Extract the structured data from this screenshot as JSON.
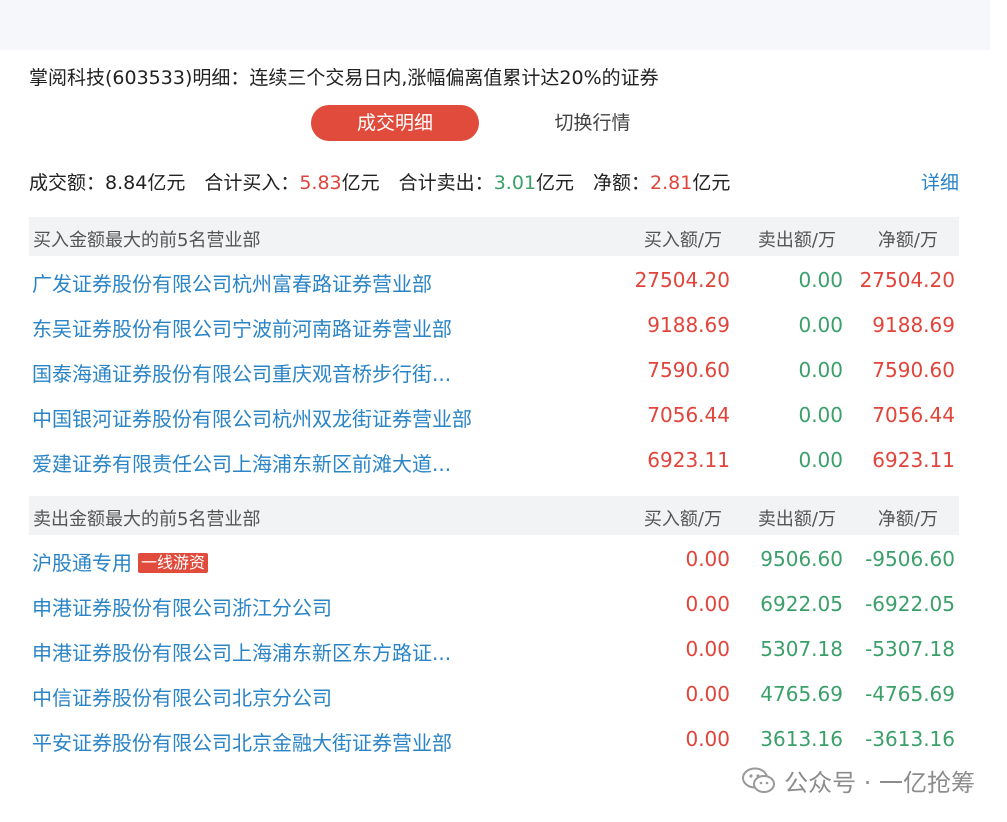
{
  "title": "掌阅科技(603533)明细：连续三个交易日内,涨幅偏离值累计达20%的证券",
  "tabs": [
    {
      "label": "成交明细",
      "active": true
    },
    {
      "label": "切换行情",
      "active": false
    }
  ],
  "summary": {
    "turnover_label": "成交额：",
    "turnover_value": "8.84亿元",
    "buy_label": "合计买入：",
    "buy_value": "5.83",
    "buy_unit": "亿元",
    "sell_label": "合计卖出：",
    "sell_value": "3.01",
    "sell_unit": "亿元",
    "net_label": "净额：",
    "net_value": "2.81",
    "net_unit": "亿元",
    "detail_link": "详细"
  },
  "buy_section": {
    "title": "买入金额最大的前5名营业部",
    "columns": [
      "买入额/万",
      "卖出额/万",
      "净额/万"
    ],
    "rows": [
      {
        "name": "广发证券股份有限公司杭州富春路证券营业部",
        "buy": "27504.20",
        "sell": "0.00",
        "net": "27504.20"
      },
      {
        "name": "东吴证券股份有限公司宁波前河南路证券营业部",
        "buy": "9188.69",
        "sell": "0.00",
        "net": "9188.69"
      },
      {
        "name": "国泰海通证券股份有限公司重庆观音桥步行街...",
        "buy": "7590.60",
        "sell": "0.00",
        "net": "7590.60"
      },
      {
        "name": "中国银河证券股份有限公司杭州双龙街证券营业部",
        "buy": "7056.44",
        "sell": "0.00",
        "net": "7056.44"
      },
      {
        "name": "爱建证券有限责任公司上海浦东新区前滩大道...",
        "buy": "6923.11",
        "sell": "0.00",
        "net": "6923.11"
      }
    ]
  },
  "sell_section": {
    "title": "卖出金额最大的前5名营业部",
    "columns": [
      "买入额/万",
      "卖出额/万",
      "净额/万"
    ],
    "rows": [
      {
        "name": "沪股通专用",
        "tag": "一线游资",
        "buy": "0.00",
        "sell": "9506.60",
        "net": "-9506.60"
      },
      {
        "name": "申港证券股份有限公司浙江分公司",
        "buy": "0.00",
        "sell": "6922.05",
        "net": "-6922.05"
      },
      {
        "name": "申港证券股份有限公司上海浦东新区东方路证...",
        "buy": "0.00",
        "sell": "5307.18",
        "net": "-5307.18"
      },
      {
        "name": "中信证券股份有限公司北京分公司",
        "buy": "0.00",
        "sell": "4765.69",
        "net": "-4765.69"
      },
      {
        "name": "平安证券股份有限公司北京金融大街证券营业部",
        "buy": "0.00",
        "sell": "3613.16",
        "net": "-3613.16"
      }
    ]
  },
  "watermark": {
    "icon": "wechat-icon",
    "text": "公众号 · 一亿抢筹"
  },
  "colors": {
    "up": "#e0443a",
    "down": "#3b9f6a",
    "link": "#2a84c6",
    "accent": "#e04b3c"
  }
}
